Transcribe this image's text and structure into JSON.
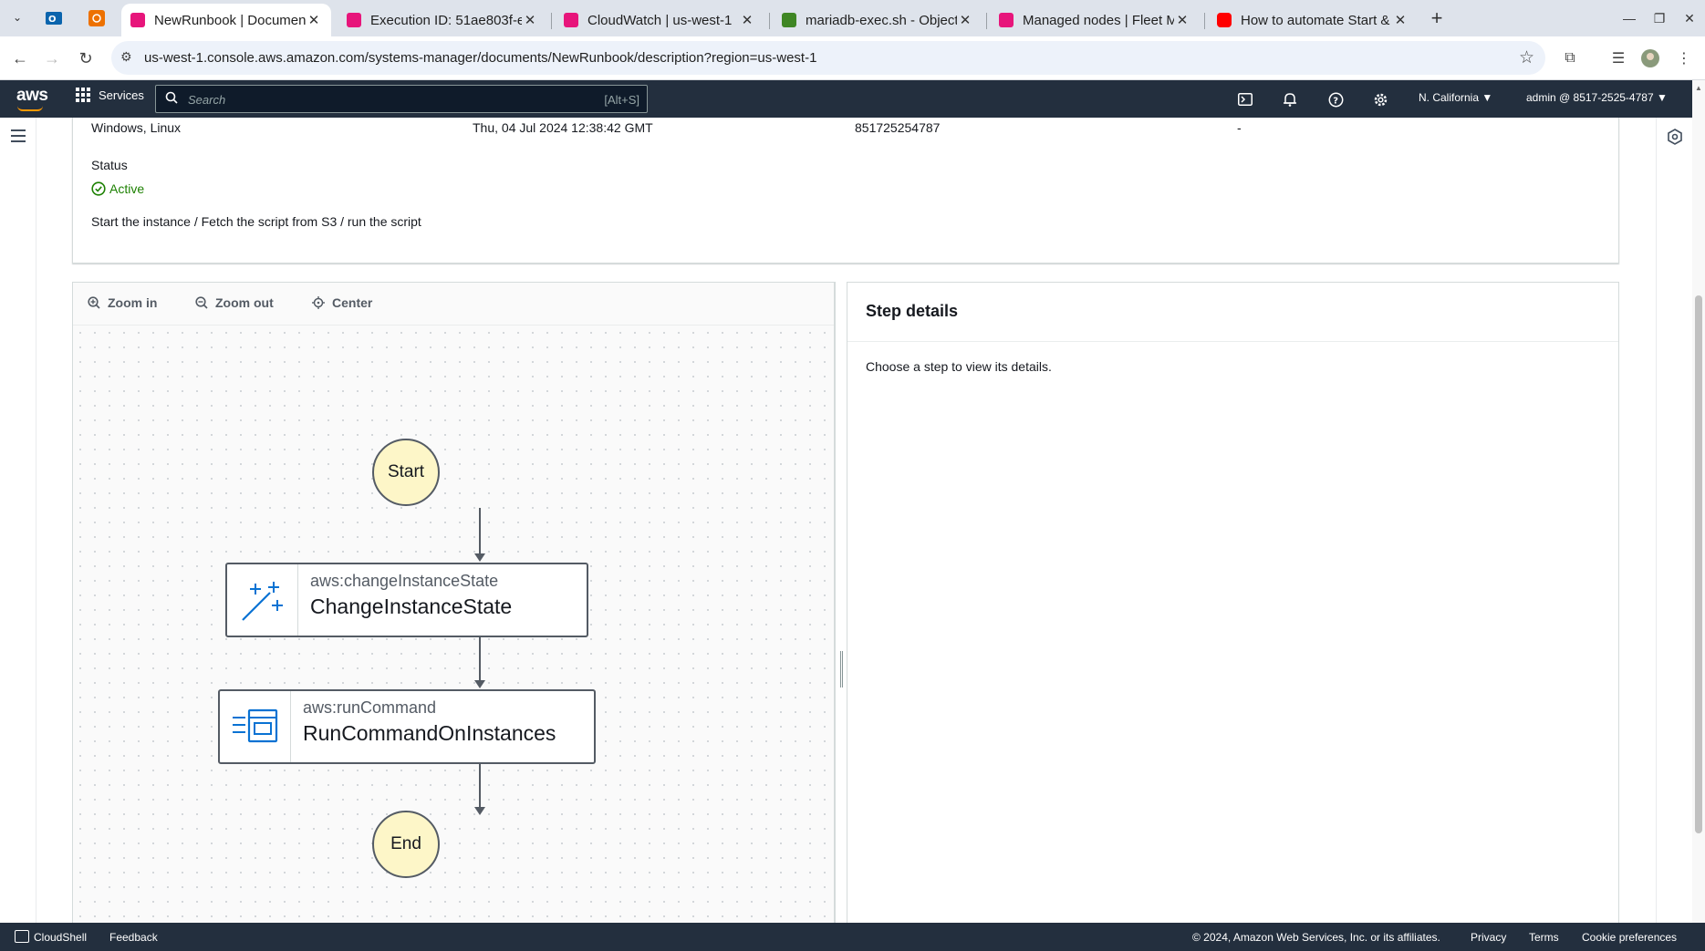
{
  "browser": {
    "tabs": [
      {
        "title": "NewRunbook | Documen",
        "fav_color": "#e7157b"
      },
      {
        "title": "Execution ID: 51ae803f-e",
        "fav_color": "#e7157b"
      },
      {
        "title": "CloudWatch | us-west-1",
        "fav_color": "#e7157b"
      },
      {
        "title": "mariadb-exec.sh - Object",
        "fav_color": "#3f8624"
      },
      {
        "title": "Managed nodes | Fleet M",
        "fav_color": "#e7157b"
      },
      {
        "title": "How to automate Start &",
        "fav_color": "#ff0000"
      }
    ],
    "url": "us-west-1.console.aws.amazon.com/systems-manager/documents/NewRunbook/description?region=us-west-1"
  },
  "awsnav": {
    "logo": "aws",
    "services": "Services",
    "search_placeholder": "Search",
    "search_shortcut": "[Alt+S]",
    "region": "N. California ▼",
    "account": "admin @ 8517-2525-4787 ▼"
  },
  "details": {
    "platforms": "Windows, Linux",
    "created": "Thu, 04 Jul 2024 12:38:42 GMT",
    "owner": "851725254787",
    "col4": "-",
    "status_label": "Status",
    "status_value": "Active",
    "description": "Start the instance / Fetch the script from S3 / run the script"
  },
  "graph": {
    "toolbar": {
      "zoom_in": "Zoom in",
      "zoom_out": "Zoom out",
      "center": "Center"
    },
    "start": "Start",
    "end": "End",
    "steps": [
      {
        "type": "aws:changeInstanceState",
        "name": "ChangeInstanceState",
        "icon": "magic-wand-icon"
      },
      {
        "type": "aws:runCommand",
        "name": "RunCommandOnInstances",
        "icon": "run-command-icon"
      }
    ]
  },
  "step_details": {
    "title": "Step details",
    "body": "Choose a step to view its details."
  },
  "footer": {
    "cloudshell": "CloudShell",
    "feedback": "Feedback",
    "copyright": "© 2024, Amazon Web Services, Inc. or its affiliates.",
    "privacy": "Privacy",
    "terms": "Terms",
    "cookies": "Cookie preferences"
  },
  "colors": {
    "aws_nav": "#232f3e",
    "status_active": "#1d8102",
    "node_fill": "#fdf6c8",
    "step_icon": "#0972d3"
  }
}
